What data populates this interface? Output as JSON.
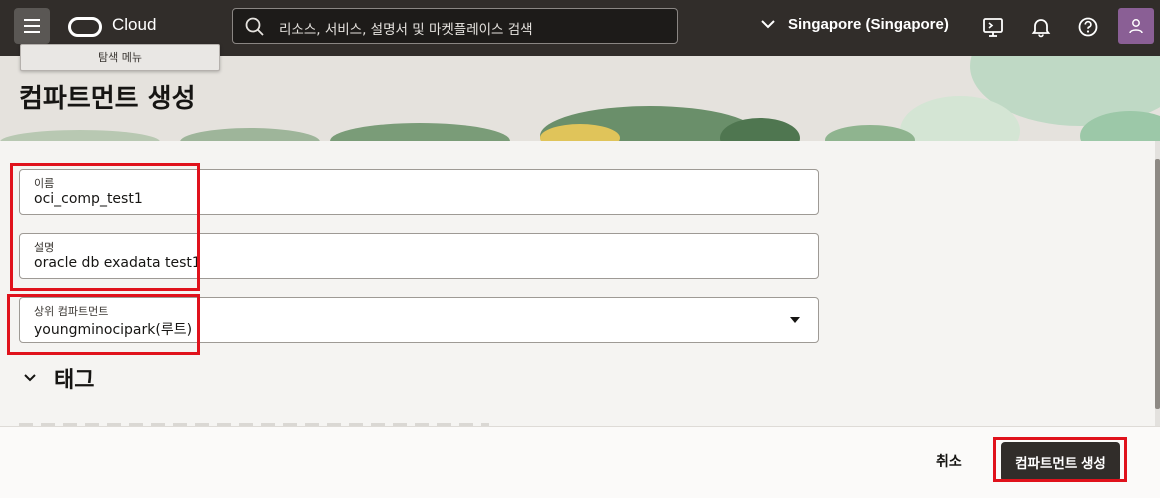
{
  "header": {
    "logo_text": "Cloud",
    "search_placeholder": "리소스, 서비스, 설명서 및 마켓플레이스 검색",
    "region": "Singapore (Singapore)",
    "icons": [
      "menu-icon",
      "search-icon",
      "chevron-down-icon",
      "cloud-shell-icon",
      "bell-icon",
      "help-icon",
      "user-icon"
    ]
  },
  "tooltip": "탐색 메뉴",
  "page": {
    "title": "컴파트먼트 생성"
  },
  "form": {
    "name": {
      "label": "이름",
      "value": "oci_comp_test1"
    },
    "description": {
      "label": "설명",
      "value": "oracle db exadata test1"
    },
    "parent": {
      "label": "상위 컴파트먼트",
      "value": "youngminocipark(루트)"
    },
    "tags_title": "태그"
  },
  "footer": {
    "cancel": "취소",
    "create": "컴파트먼트 생성"
  },
  "colors": {
    "topbar": "#312d2a",
    "highlight": "#e0121c",
    "button": "#312d2a"
  }
}
